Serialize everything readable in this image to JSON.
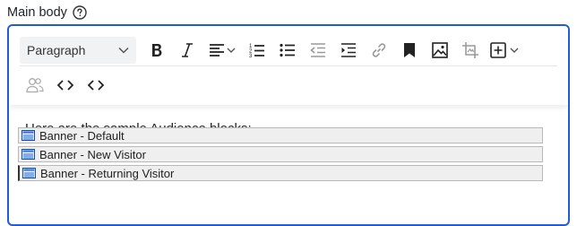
{
  "field": {
    "label": "Main body",
    "help_icon": "question-circle-icon"
  },
  "toolbar": {
    "format_select": "Paragraph",
    "buttons_row1": [
      {
        "name": "bold-button",
        "icon": "bold-icon"
      },
      {
        "name": "italic-button",
        "icon": "italic-icon"
      },
      {
        "name": "align-dropdown",
        "icon": "align-left-icon"
      },
      {
        "name": "ordered-list-button",
        "icon": "ordered-list-icon"
      },
      {
        "name": "bullet-list-button",
        "icon": "bullet-list-icon"
      },
      {
        "name": "outdent-button",
        "icon": "outdent-icon"
      },
      {
        "name": "indent-button",
        "icon": "indent-icon"
      },
      {
        "name": "link-button",
        "icon": "link-icon"
      },
      {
        "name": "bookmark-button",
        "icon": "bookmark-icon"
      },
      {
        "name": "image-button",
        "icon": "image-icon"
      },
      {
        "name": "crop-button",
        "icon": "crop-icon"
      },
      {
        "name": "insert-dropdown",
        "icon": "plus-square-icon"
      }
    ],
    "buttons_row2": [
      {
        "name": "audience-button",
        "icon": "users-icon"
      },
      {
        "name": "code-button",
        "icon": "code-icon"
      },
      {
        "name": "source-code-button",
        "icon": "code-icon"
      }
    ]
  },
  "content": {
    "intro": "Here are the sample Audience blocks:",
    "blocks": [
      "Banner - Default",
      "Banner - New Visitor",
      "Banner - Returning Visitor"
    ]
  }
}
